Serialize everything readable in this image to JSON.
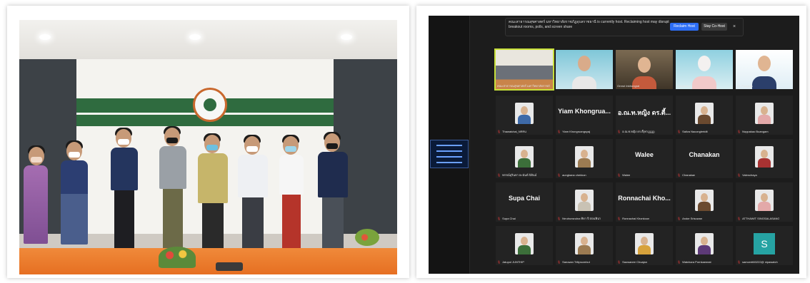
{
  "zoom": {
    "banner": {
      "message": "คณะสาธารณสุขศาสตร์ มหาวิทยาลัยราชภัฏอุบลราชธานี is currently host. Reclaiming host may disrupt breakout rooms, polls, and screen share",
      "reclaim_label": "Reclaim Host",
      "cohost_label": "Stay Co-Host",
      "close_label": "×"
    },
    "video_tiles": [
      {
        "name": "คณะสาธารณสุขศาสตร์ มหาวิทยาลัยราชภัฏอุบลราชธานี"
      },
      {
        "name": ""
      },
      {
        "name": "Ornrut Inkhongrat"
      },
      {
        "name": "Doraemon"
      },
      {
        "name": "Dr. Pongsak"
      }
    ],
    "grid": [
      [
        {
          "label": "Thawatchai_NRRU",
          "display": "avatar"
        },
        {
          "label": "Yiam Khongruangsyaj",
          "display": "name",
          "big": "Yiam Khongrua..."
        },
        {
          "label": "อ.ณ.ท.หญิง ดร.ตี้(ฟาฎฎฎ)",
          "display": "name",
          "big": "อ.ณ.ท.หญิง ดร.ตี้..."
        },
        {
          "label": "Saliva Naconglertdit",
          "display": "avatar"
        },
        {
          "label": "Noppakao Buangam",
          "display": "avatar"
        }
      ],
      [
        {
          "label": "พรรณ์อุรินทา ยะนันท์ นิธินน์",
          "display": "avatar"
        },
        {
          "label": "aungkana chekkon",
          "display": "avatar"
        },
        {
          "label": "Walee",
          "display": "name",
          "big": "Walee"
        },
        {
          "label": "Chanakan",
          "display": "name",
          "big": "Chanakan"
        },
        {
          "label": "Valenchaya",
          "display": "avatar"
        }
      ],
      [
        {
          "label": "Supa Chai",
          "display": "name",
          "big": "Supa Chai"
        },
        {
          "label": "Nrruhunsrulna ทิดา ปี สอนฟิน่า",
          "display": "avatar"
        },
        {
          "label": "Ronnachai Khonkoon",
          "display": "name",
          "big": "Ronnachai Kho..."
        },
        {
          "label": "Aroke Srisuwan",
          "display": "avatar"
        },
        {
          "label": "ATTHAWIT SINGSALASANG",
          "display": "avatar"
        }
      ],
      [
        {
          "label": "Jatupol JUNTHIP",
          "display": "avatar"
        },
        {
          "label": "Saruwan Tritipsombut",
          "display": "avatar"
        },
        {
          "label": "Saowanee Chuajan",
          "display": "avatar"
        },
        {
          "label": "Watchara Pornkaewrat",
          "display": "avatar"
        },
        {
          "label": "samornit60222@ nipawatch",
          "display": "letter",
          "big": "S"
        }
      ]
    ]
  },
  "colors": {
    "zoom_bg": "#1c1c1c",
    "tile_bg": "#232323",
    "reclaim_blue": "#2d6ef5",
    "mic_off_red": "#e23a3a",
    "speaker_highlight": "#c8e03a",
    "avatar_S": "#26a3a3"
  }
}
